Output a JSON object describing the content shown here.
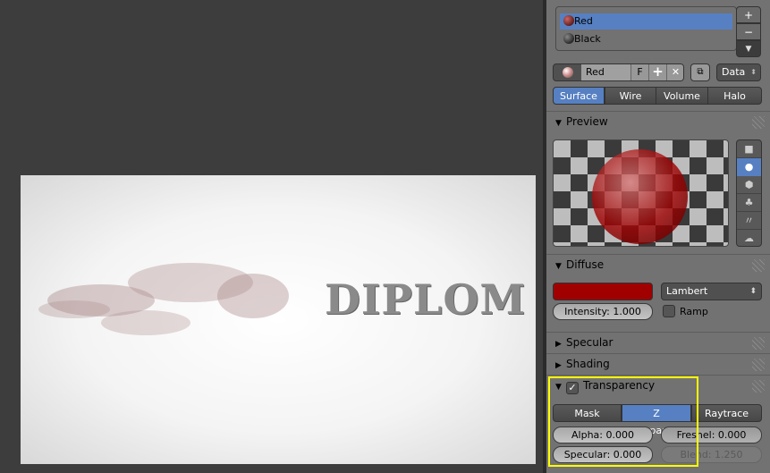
{
  "viewport": {
    "render_text": "DIPLOM"
  },
  "materials": {
    "slots": [
      {
        "name": "Red",
        "selected": true
      },
      {
        "name": "Black",
        "selected": false
      }
    ]
  },
  "material_bar": {
    "name": "Red",
    "fake_user": "F",
    "link": "Data"
  },
  "type_tabs": [
    {
      "label": "Surface",
      "active": true
    },
    {
      "label": "Wire"
    },
    {
      "label": "Volume"
    },
    {
      "label": "Halo"
    }
  ],
  "panels": {
    "preview": "Preview",
    "diffuse": {
      "title": "Diffuse",
      "color": "#a00000",
      "shader": "Lambert",
      "intensity": "Intensity: 1.000",
      "ramp": "Ramp"
    },
    "specular": "Specular",
    "shading": "Shading",
    "transparency": {
      "title": "Transparency",
      "enabled": true,
      "modes": [
        {
          "label": "Mask"
        },
        {
          "label": "Z Transparency",
          "active": true
        },
        {
          "label": "Raytrace"
        }
      ],
      "alpha": "Alpha: 0.000",
      "fresnel": "Fresnel: 0.000",
      "specular": "Specular: 0.000",
      "blend": "Blend: 1.250"
    }
  },
  "colors": {
    "accent": "#5680c2",
    "highlight": "#ffff00"
  }
}
